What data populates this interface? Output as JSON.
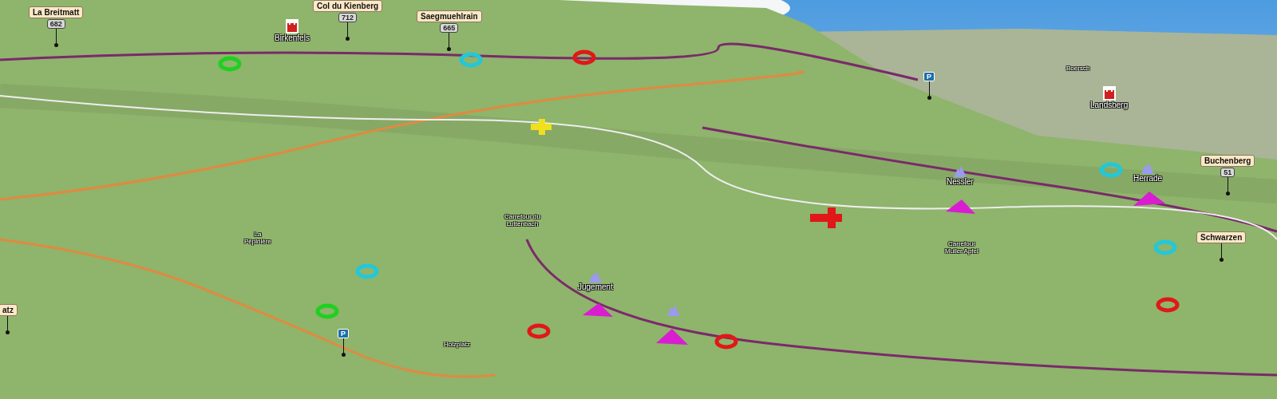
{
  "map": {
    "labels": [
      {
        "kind": "tag",
        "lines": [
          "La Breitmatt"
        ],
        "elevation": "682"
      },
      {
        "kind": "tag",
        "lines": [
          "Col du Kienberg"
        ],
        "elevation": "712"
      },
      {
        "kind": "tag",
        "lines": [
          "Saegmuehlrain"
        ],
        "elevation": "665"
      },
      {
        "kind": "castle",
        "lines": [
          "Birkenfels"
        ]
      },
      {
        "kind": "place",
        "lines": [
          "Boersch"
        ]
      },
      {
        "kind": "castle",
        "lines": [
          "Landsberg"
        ]
      },
      {
        "kind": "tag",
        "lines": [
          "Buchenberg"
        ],
        "elevation": "51"
      },
      {
        "kind": "tag",
        "lines": [
          "Schwarzen"
        ]
      },
      {
        "kind": "peak",
        "lines": [
          "Nessler"
        ]
      },
      {
        "kind": "peak",
        "lines": [
          "Herrade"
        ]
      },
      {
        "kind": "peak",
        "lines": [
          "Jugement"
        ]
      },
      {
        "kind": "peak"
      },
      {
        "kind": "place",
        "lines": [
          "Carrefour",
          "Muller Apfel"
        ]
      },
      {
        "kind": "place",
        "lines": [
          "Carrefour du",
          "Luttenbach"
        ]
      },
      {
        "kind": "place",
        "lines": [
          "La",
          "Pépinière"
        ]
      },
      {
        "kind": "place",
        "lines": [
          "Holzplatz"
        ]
      },
      {
        "kind": "tag",
        "lines": [
          "atz"
        ]
      },
      {
        "kind": "parking",
        "lines": [
          "P"
        ]
      },
      {
        "kind": "parking",
        "lines": [
          "P"
        ]
      }
    ]
  }
}
